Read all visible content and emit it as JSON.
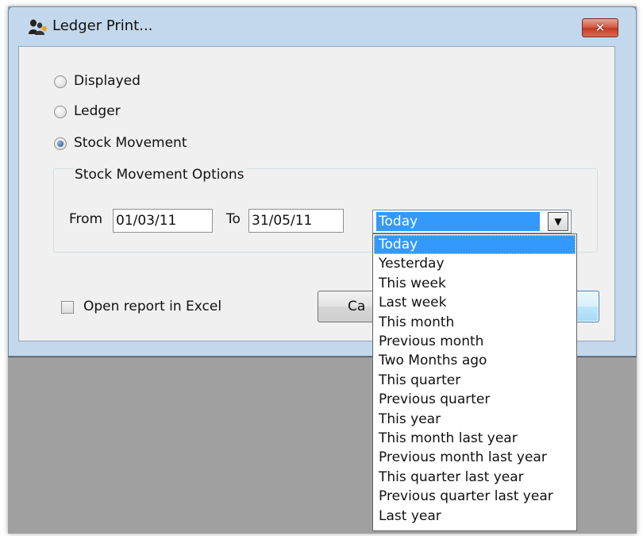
{
  "dialog": {
    "title": "Ledger Print...",
    "close_label": "✕"
  },
  "report_type": {
    "selected": "Stock Movement",
    "options": [
      {
        "label": "Displayed",
        "checked": false
      },
      {
        "label": "Ledger",
        "checked": false
      },
      {
        "label": "Stock Movement",
        "checked": true
      }
    ]
  },
  "stock_movement_options": {
    "legend": "Stock Movement Options",
    "from_label": "From",
    "from_value": "01/03/11",
    "to_label": "To",
    "to_value": "31/05/11",
    "range_selected": "Today",
    "range_arrow": "▼",
    "range_options": [
      "Today",
      "Yesterday",
      "This week",
      "Last week",
      "This month",
      "Previous month",
      "Two Months ago",
      "This quarter",
      "Previous quarter",
      "This year",
      "This month last year",
      "Previous month last year",
      "This quarter last year",
      "Previous quarter last year",
      "Last year"
    ]
  },
  "excel": {
    "label": "Open report in Excel",
    "checked": false
  },
  "buttons": {
    "cancel_label": "Ca"
  },
  "colors": {
    "selection": "#3399ff",
    "dialog_frame": "#c4d8ed",
    "close_button": "#c9452d"
  }
}
